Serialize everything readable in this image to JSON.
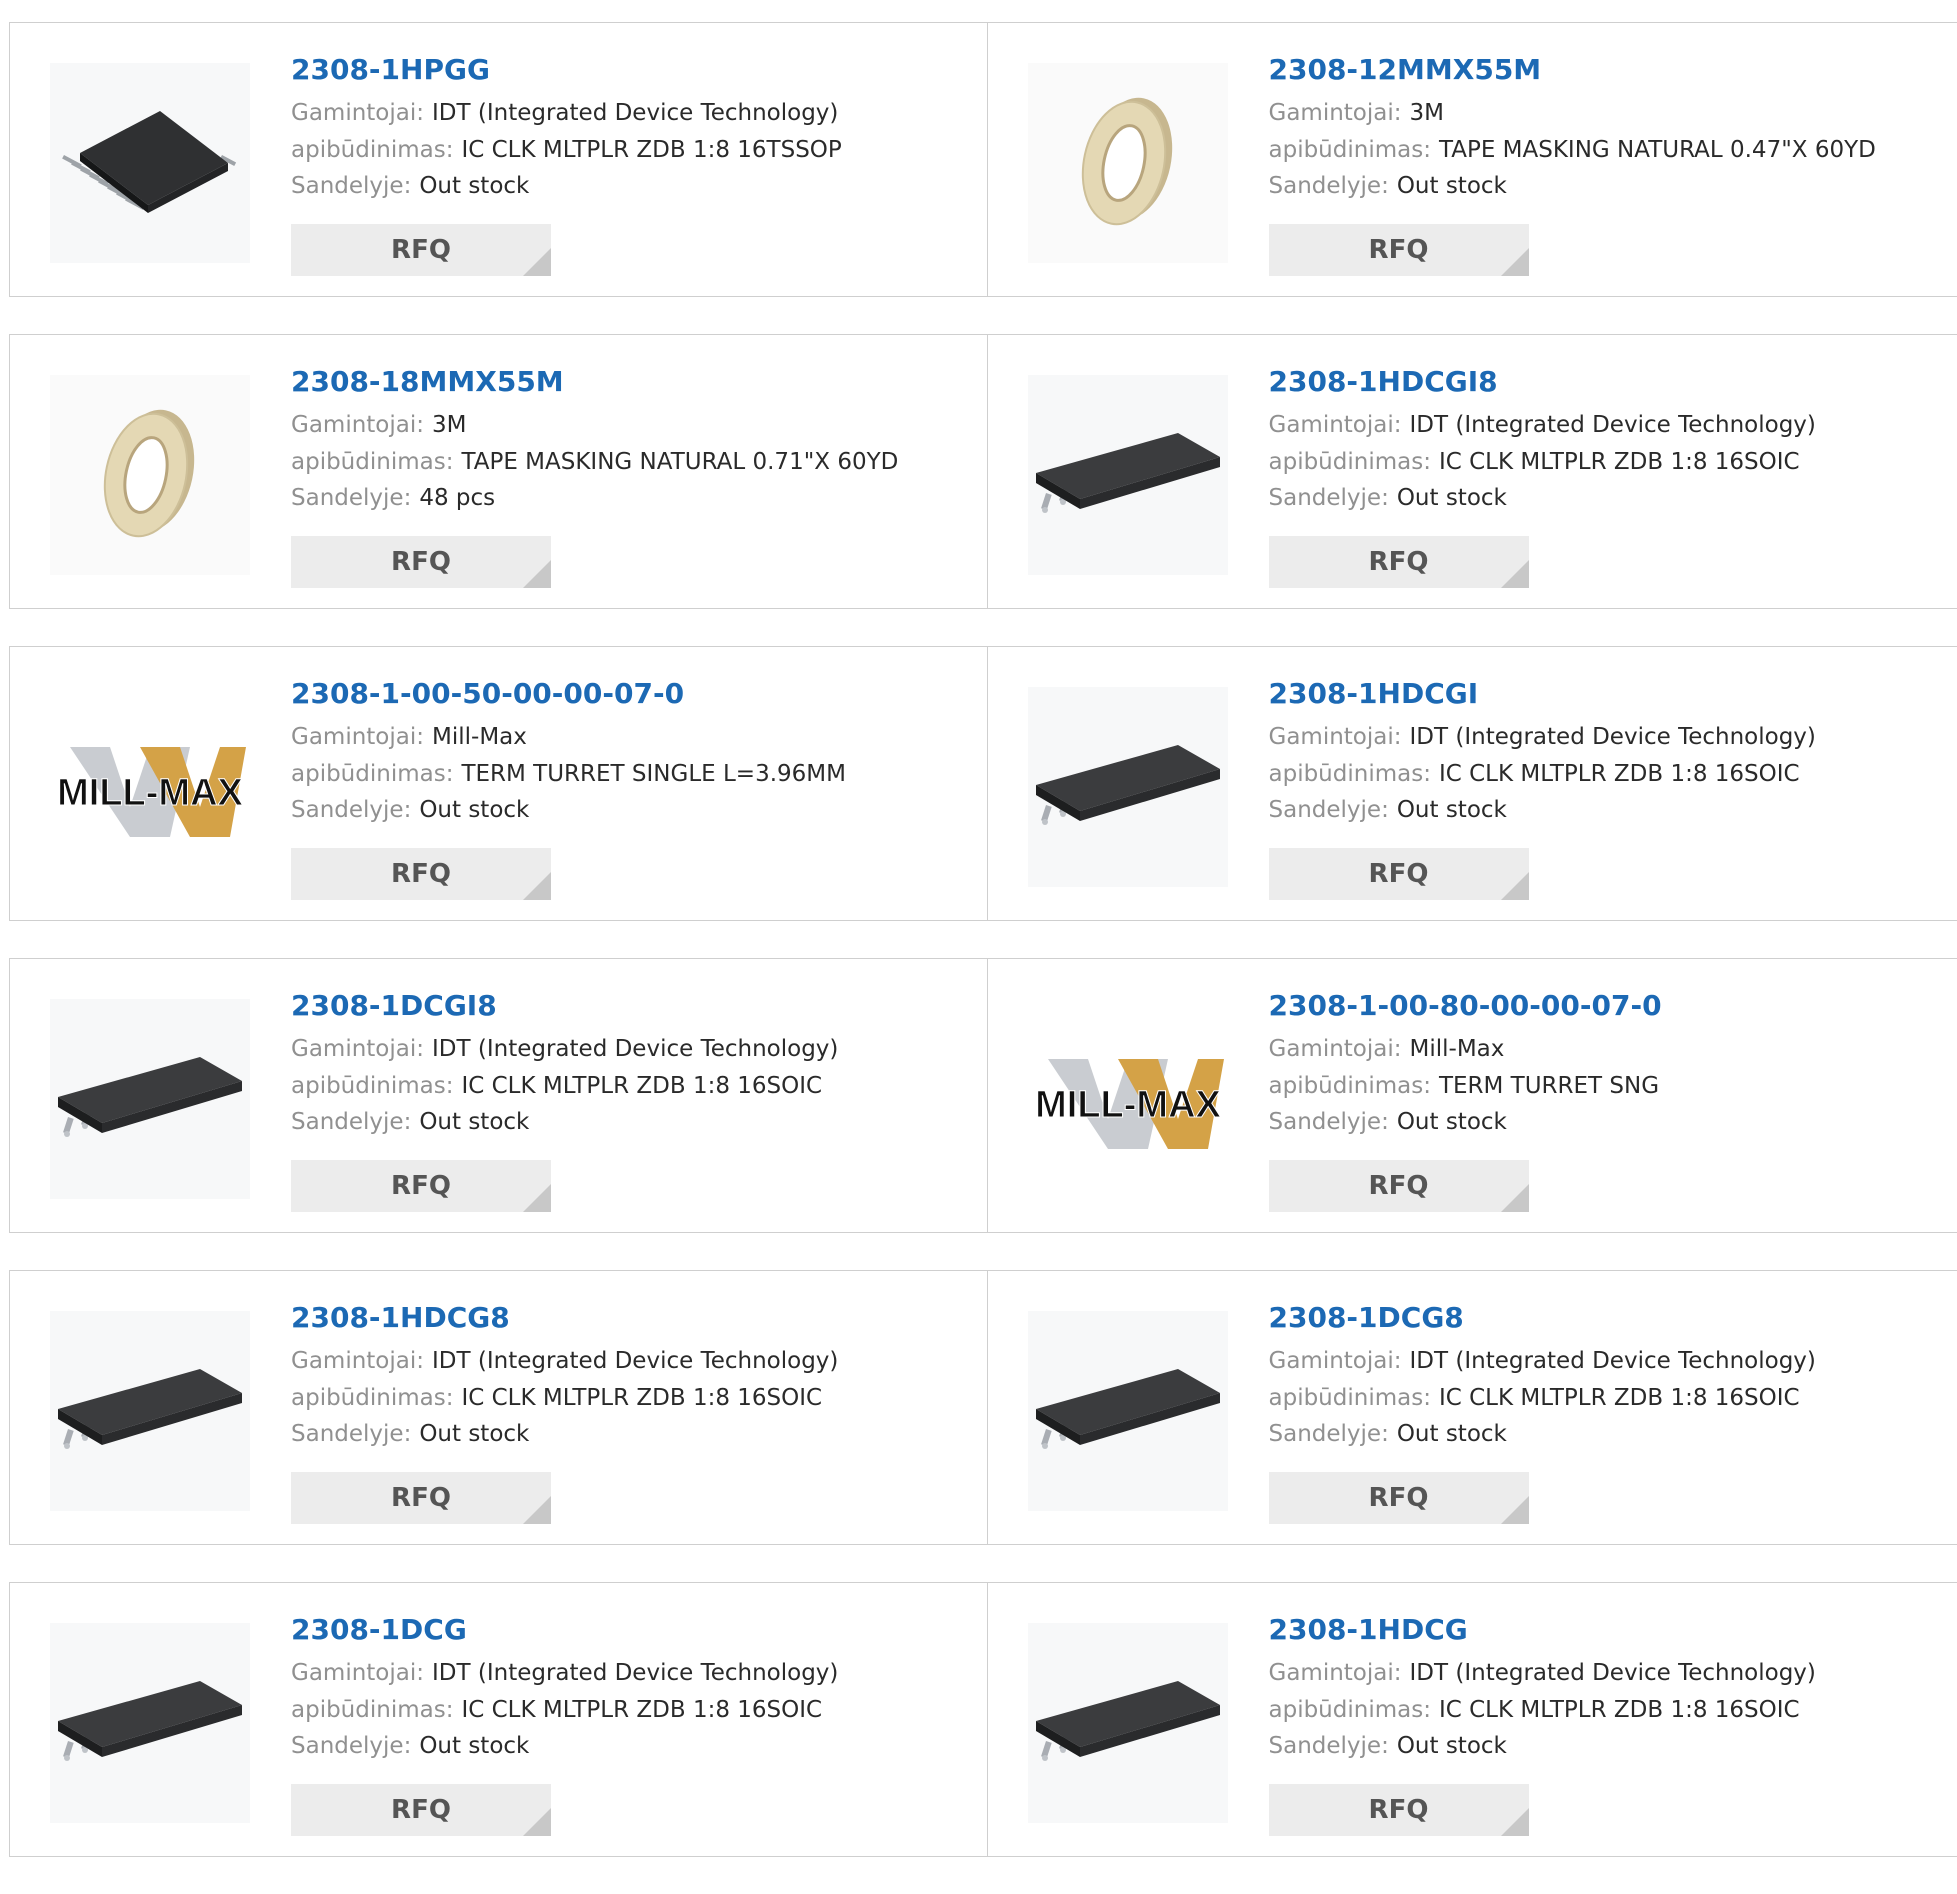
{
  "labels": {
    "manufacturer": "Gamintojai:",
    "description": "apibūdinimas:",
    "stock": "Sandelyje:",
    "rfq": "RFQ"
  },
  "colors": {
    "part_link": "#1c69b4",
    "label": "#909090",
    "button_bg": "#ececec"
  },
  "products": [
    {
      "part": "2308-1HPGG",
      "manufacturer": "IDT (Integrated Device Technology)",
      "description": "IC CLK MLTPLR ZDB 1:8 16TSSOP",
      "stock": "Out stock",
      "image": "tssop-chip-icon"
    },
    {
      "part": "2308-12MMX55M",
      "manufacturer": "3M",
      "description": "TAPE MASKING NATURAL 0.47\"X 60YD",
      "stock": "Out stock",
      "image": "tape-roll-icon"
    },
    {
      "part": "2308-18MMX55M",
      "manufacturer": "3M",
      "description": "TAPE MASKING NATURAL 0.71\"X 60YD",
      "stock": "48 pcs",
      "image": "tape-roll-icon"
    },
    {
      "part": "2308-1HDCGI8",
      "manufacturer": "IDT (Integrated Device Technology)",
      "description": "IC CLK MLTPLR ZDB 1:8 16SOIC",
      "stock": "Out stock",
      "image": "soic-chip-icon"
    },
    {
      "part": "2308-1-00-50-00-00-07-0",
      "manufacturer": "Mill-Max",
      "description": "TERM TURRET SINGLE L=3.96MM",
      "stock": "Out stock",
      "image": "mill-max-logo",
      "logo_text": "MILL-MAX"
    },
    {
      "part": "2308-1HDCGI",
      "manufacturer": "IDT (Integrated Device Technology)",
      "description": "IC CLK MLTPLR ZDB 1:8 16SOIC",
      "stock": "Out stock",
      "image": "soic-chip-icon"
    },
    {
      "part": "2308-1DCGI8",
      "manufacturer": "IDT (Integrated Device Technology)",
      "description": "IC CLK MLTPLR ZDB 1:8 16SOIC",
      "stock": "Out stock",
      "image": "soic-chip-icon"
    },
    {
      "part": "2308-1-00-80-00-00-07-0",
      "manufacturer": "Mill-Max",
      "description": "TERM TURRET SNG",
      "stock": "Out stock",
      "image": "mill-max-logo",
      "logo_text": "MILL-MAX"
    },
    {
      "part": "2308-1HDCG8",
      "manufacturer": "IDT (Integrated Device Technology)",
      "description": "IC CLK MLTPLR ZDB 1:8 16SOIC",
      "stock": "Out stock",
      "image": "soic-chip-icon"
    },
    {
      "part": "2308-1DCG8",
      "manufacturer": "IDT (Integrated Device Technology)",
      "description": "IC CLK MLTPLR ZDB 1:8 16SOIC",
      "stock": "Out stock",
      "image": "soic-chip-icon"
    },
    {
      "part": "2308-1DCG",
      "manufacturer": "IDT (Integrated Device Technology)",
      "description": "IC CLK MLTPLR ZDB 1:8 16SOIC",
      "stock": "Out stock",
      "image": "soic-chip-icon"
    },
    {
      "part": "2308-1HDCG",
      "manufacturer": "IDT (Integrated Device Technology)",
      "description": "IC CLK MLTPLR ZDB 1:8 16SOIC",
      "stock": "Out stock",
      "image": "soic-chip-icon"
    }
  ]
}
